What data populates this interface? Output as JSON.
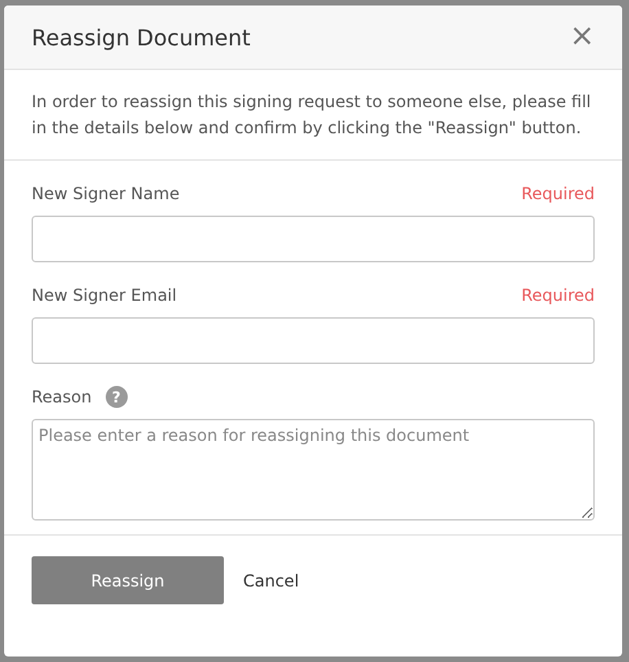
{
  "dialog": {
    "title": "Reassign Document",
    "close": "×",
    "description": "In order to reassign this signing request to someone else, please fill in the details below and confirm by clicking the \"Reassign\" button."
  },
  "fields": [
    {
      "kind": "input",
      "label": "New Signer Name",
      "required": "Required"
    },
    {
      "kind": "input",
      "label": "New Signer Email",
      "required": "Required"
    },
    {
      "kind": "textarea",
      "label": "Reason",
      "help": "?",
      "placeholder": "Please enter a reason for reassigning this document"
    }
  ],
  "buttons": {
    "primary": "Reassign",
    "secondary": "Cancel"
  }
}
